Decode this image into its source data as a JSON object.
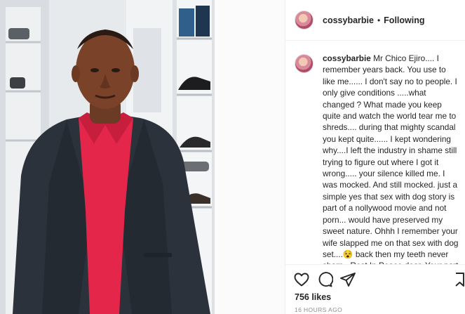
{
  "post": {
    "username": "cossybarbie",
    "separator": "•",
    "follow_status": "Following"
  },
  "caption": {
    "username": "cossybarbie",
    "text": "Mr Chico Ejiro.... I remember years back. You use to like me...... I don't say no to people. I only give conditions .....what changed ? What made you keep quite and watch the world tear me to shreds.... during that mighty scandal you kept quite...... I kept wondering why....I left the industry in shame still trying to figure out where I got it wrong..... your silence killed me. I was mocked. And still mocked. just a simple yes that sex with dog story is part of a nollywood movie and not porn... would have preserved my sweet nature. Ohhh I remember your wife slapped me on that sex with dog set....😵 back then my teeth never sharp . Rest In Peace dear. Your part of my history and also My birthday mate. 🖤"
  },
  "footer": {
    "likes": "756 likes",
    "timestamp": "16 HOURS AGO"
  },
  "icons": {
    "like": "heart-icon",
    "comment": "comment-icon",
    "share": "share-icon",
    "save": "bookmark-icon"
  },
  "colors": {
    "shirt": "#e5264b",
    "suit": "#2b323b",
    "muted_text": "#8e8e8e"
  }
}
